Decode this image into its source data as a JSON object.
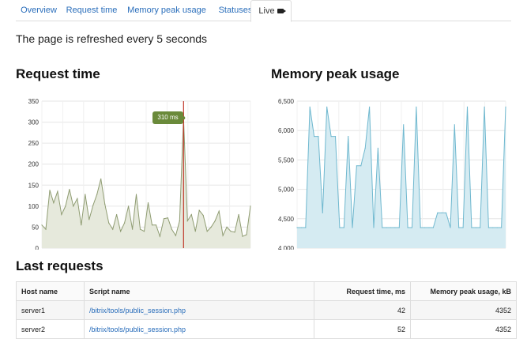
{
  "tabs": [
    {
      "label": "Overview"
    },
    {
      "label": "Request time"
    },
    {
      "label": "Memory peak usage"
    },
    {
      "label": "Statuses"
    },
    {
      "label": "Live",
      "active": true
    }
  ],
  "refresh_text": "The page is refreshed every 5 seconds",
  "headings": {
    "request_time": "Request time",
    "memory_peak": "Memory peak usage",
    "last_requests": "Last requests"
  },
  "tooltip": "310 ms",
  "chart_data": [
    {
      "type": "area",
      "title": "Request time",
      "ylim": [
        0,
        350
      ],
      "yticks": [
        0,
        50,
        100,
        150,
        200,
        250,
        300,
        350
      ],
      "yticks_labels": [
        "0",
        "50",
        "100",
        "150",
        "200",
        "250",
        "300",
        "350"
      ],
      "grid": true,
      "color": "#8f9c72",
      "fill": "#e6e9dc",
      "highlight_index": 36,
      "values": [
        55,
        45,
        138,
        108,
        135,
        80,
        100,
        140,
        100,
        118,
        55,
        128,
        68,
        102,
        128,
        165,
        105,
        60,
        45,
        80,
        40,
        60,
        100,
        45,
        128,
        45,
        40,
        108,
        55,
        55,
        28,
        70,
        72,
        45,
        30,
        65,
        310,
        65,
        80,
        40,
        90,
        78,
        40,
        50,
        65,
        88,
        30,
        50,
        40,
        38,
        80,
        28,
        32,
        100
      ]
    },
    {
      "type": "area",
      "title": "Memory peak usage",
      "ylim": [
        4000,
        6500
      ],
      "yticks": [
        4000,
        4500,
        5000,
        5500,
        6000,
        6500
      ],
      "yticks_labels": [
        "4,000",
        "4,500",
        "5,000",
        "5,500",
        "6,000",
        "6,500"
      ],
      "grid": true,
      "color": "#6fb8cf",
      "fill": "#d5ebf2",
      "values": [
        4350,
        4350,
        4350,
        6400,
        5900,
        5900,
        4600,
        6400,
        5900,
        5900,
        4350,
        4350,
        5900,
        4350,
        5400,
        5400,
        5700,
        6400,
        4350,
        5700,
        4350,
        4350,
        4350,
        4350,
        4350,
        6100,
        4350,
        4350,
        6400,
        4350,
        4350,
        4350,
        4350,
        4600,
        4600,
        4600,
        4350,
        6100,
        4350,
        4350,
        6400,
        4350,
        4350,
        4350,
        6400,
        4350,
        4350,
        4350,
        4350,
        6400
      ]
    }
  ],
  "table": {
    "headers": [
      "Host name",
      "Script name",
      "Request time, ms",
      "Memory peak usage, kB"
    ],
    "rows": [
      [
        "server1",
        "/bitrix/tools/public_session.php",
        "42",
        "4352"
      ],
      [
        "server2",
        "/bitrix/tools/public_session.php",
        "52",
        "4352"
      ]
    ]
  }
}
